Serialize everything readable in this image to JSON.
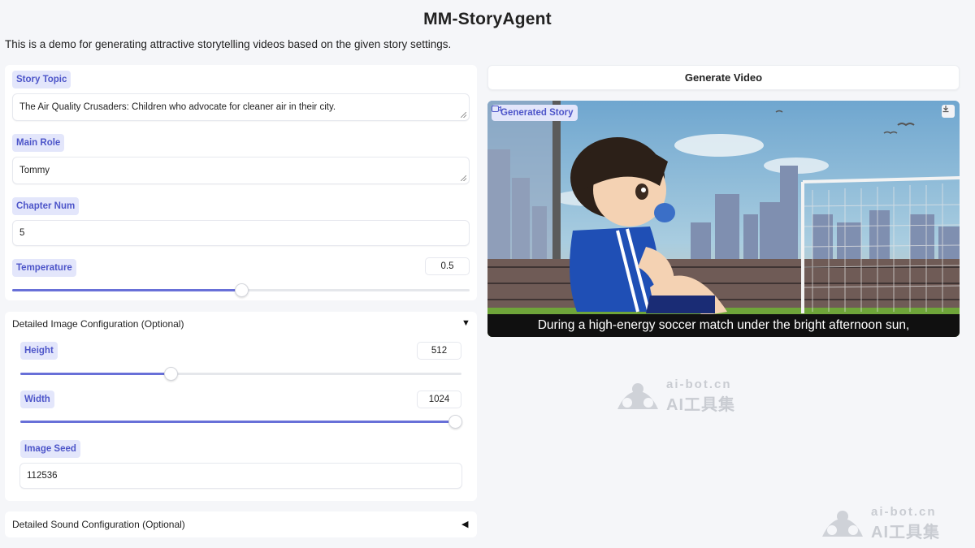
{
  "header": {
    "title": "MM-StoryAgent",
    "subtitle": "This is a demo for generating attractive storytelling videos based on the given story settings."
  },
  "settings": {
    "story_topic": {
      "label": "Story Topic",
      "value": "The Air Quality Crusaders: Children who advocate for cleaner air in their city."
    },
    "main_role": {
      "label": "Main Role",
      "value": "Tommy"
    },
    "chapter_num": {
      "label": "Chapter Num",
      "value": "5"
    },
    "temperature": {
      "label": "Temperature",
      "value": "0.5",
      "fraction": 0.5
    }
  },
  "image_config": {
    "header": "Detailed Image Configuration (Optional)",
    "expanded_arrow": "▼",
    "height": {
      "label": "Height",
      "value": "512",
      "fraction": 0.34
    },
    "width": {
      "label": "Width",
      "value": "1024",
      "fraction": 1.0
    },
    "seed": {
      "label": "Image Seed",
      "value": "112536"
    }
  },
  "sound_config": {
    "header": "Detailed Sound Configuration (Optional)",
    "collapsed_arrow": "◀"
  },
  "output": {
    "generate_label": "Generate Video",
    "video_label": "Generated Story",
    "video_icon": "video-camera-icon",
    "download_icon": "download-icon",
    "caption": "During a high-energy soccer match under the bright afternoon sun,"
  },
  "watermark": {
    "line1": "ai-bot.cn",
    "line2": "AI工具集"
  },
  "colors": {
    "accent": "#6870d8",
    "badge_bg": "#e3e6fb",
    "badge_text": "#4d55c9",
    "page_bg": "#f5f6f9"
  }
}
